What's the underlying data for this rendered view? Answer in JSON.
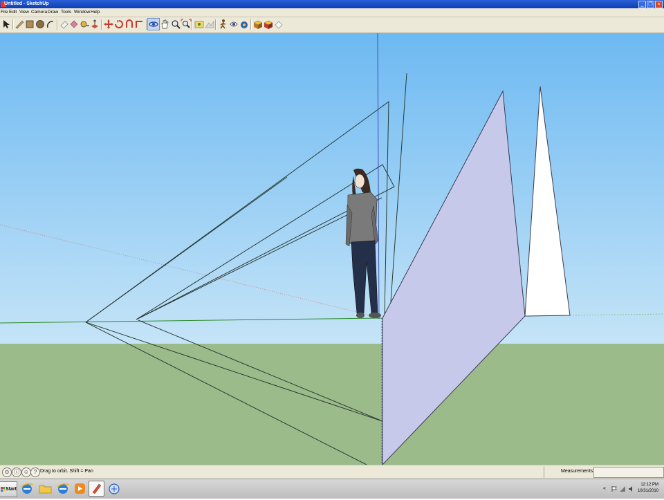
{
  "window": {
    "title": "Untitled - SketchUp",
    "controls": [
      "minimize",
      "restore",
      "close"
    ]
  },
  "menu": {
    "items": [
      "File",
      "Edit",
      "View",
      "Camera",
      "Draw",
      "Tools",
      "Window",
      "Help"
    ]
  },
  "toolbar": {
    "tools": [
      "select-icon",
      "pencil-icon",
      "rectangle-icon",
      "circle-icon",
      "arc-icon",
      "eraser-icon",
      "paint-bucket-icon",
      "tape-measure-icon",
      "push-pull-icon",
      "move-icon",
      "rotate-icon",
      "follow-me-icon",
      "orbit-icon",
      "pan-icon",
      "zoom-icon",
      "zoom-extents-icon",
      "add-location-icon",
      "toggle-terrain-icon",
      "walk-icon",
      "look-around-icon",
      "position-camera-icon",
      "get-models-icon",
      "share-model-icon",
      "share-component-icon"
    ],
    "active_tool": "orbit-icon"
  },
  "viewport": {
    "sky_top": "#6db9f2",
    "sky_bottom": "#c5e4f7",
    "ground": "#9bbb8a",
    "plane_fill": "#c7c9ea",
    "figure": "person-standing"
  },
  "status": {
    "hint": "Drag to orbit.  Shift = Pan",
    "measurements_label": "Measurements",
    "measurements_value": ""
  },
  "taskbar": {
    "start_label": "Start",
    "clock_time": "12:12 PM",
    "clock_date": "10/31/2010"
  }
}
